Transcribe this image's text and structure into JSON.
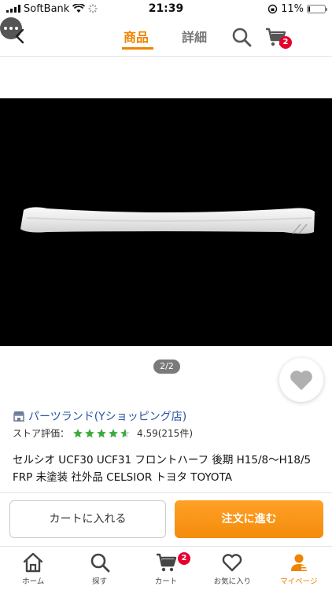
{
  "status_bar": {
    "carrier": "SoftBank",
    "time": "21:39",
    "battery": "11%",
    "battery_level": 0.11
  },
  "nav": {
    "tab_product": "商品",
    "tab_detail": "詳細",
    "cart_count": "2"
  },
  "gallery": {
    "page_indicator": "2/2"
  },
  "store": {
    "name": "パーツランド(Yショッピング店)",
    "rating_label": "ストア評価：",
    "rating_value": "4.59(215件)",
    "stars": 4.59
  },
  "product": {
    "title": "セルシオ UCF30 UCF31 フロントハーフ 後期 H15/8〜H18/5 FRP 未塗装 社外品 CELSIOR トヨタ TOYOTA"
  },
  "actions": {
    "add_to_cart": "カートに入れる",
    "order": "注文に進む"
  },
  "tabbar": {
    "items": [
      {
        "label": "ホーム",
        "icon": "home-icon"
      },
      {
        "label": "探す",
        "icon": "search-icon"
      },
      {
        "label": "カート",
        "icon": "cart-icon",
        "badge": "2"
      },
      {
        "label": "お気に入り",
        "icon": "heart-icon"
      },
      {
        "label": "マイページ",
        "icon": "person-icon"
      }
    ]
  },
  "colors": {
    "accent": "#f08300",
    "link": "#2554a3",
    "badge": "#e6002d",
    "star": "#3cab3c"
  }
}
